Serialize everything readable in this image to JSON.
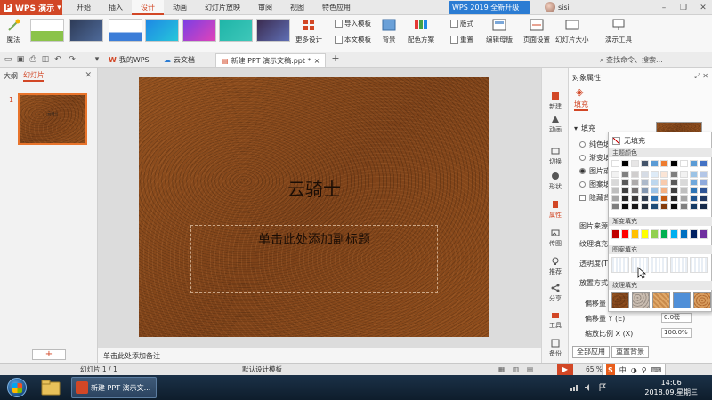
{
  "app": {
    "name": "WPS 演示",
    "accent_color": "#d24726",
    "menu_tabs": [
      "开始",
      "插入",
      "设计",
      "动画",
      "幻灯片放映",
      "审阅",
      "视图",
      "特色应用"
    ],
    "active_menu_tab": "设计",
    "upgrade_label": "WPS 2019 全新升级",
    "user_name": "sisi"
  },
  "ribbon": {
    "magic_label": "魔法",
    "more_designs_label": "更多设计",
    "import_template_label": "导入模板",
    "this_file_template_label": "本文模板",
    "background_label": "背景",
    "color_scheme_label": "配色方案",
    "layout_label": "版式",
    "rearrange_label": "重置",
    "edit_master_label": "编辑母版",
    "page_setup_label": "页面设置",
    "slide_size_label": "幻灯片大小",
    "presenter_tools_label": "演示工具"
  },
  "doc_tabs": [
    {
      "label": "我的WPS",
      "active": false
    },
    {
      "label": "云文档",
      "active": false
    },
    {
      "label": "新建 PPT 演示文稿.ppt *",
      "active": true
    }
  ],
  "search_placeholder": "查找命令、搜索...",
  "left_pane": {
    "tabs": [
      "大纲",
      "幻灯片"
    ],
    "active_tab": "幻灯片",
    "slide_number": "1",
    "thumb_title": "云骑士"
  },
  "slide": {
    "title": "云骑士",
    "subtitle_placeholder": "单击此处添加副标题"
  },
  "notes_placeholder": "单击此处添加备注",
  "side_buttons": [
    "新建",
    "动画",
    "切换",
    "形状",
    "属性",
    "传图",
    "推荐",
    "分享",
    "工具",
    "备份"
  ],
  "active_side_button": "属性",
  "task_pane": {
    "title": "对象属性",
    "fill_tab": "填充",
    "fill_section": "填充",
    "options": [
      "纯色填充",
      "渐变填充",
      "图片或纹理填充",
      "图案填充"
    ],
    "options_short": [
      "纯色填",
      "渐变填",
      "图片或",
      "图案填"
    ],
    "selected_option_index": 2,
    "hide_bg_label": "隐藏背",
    "picture_source_label": "图片来源",
    "texture_fill_label": "纹理填充(",
    "transparency_label": "透明度(T)",
    "placement_label": "放置方式",
    "offset_x_label": "偏移量",
    "offset_y_label": "偏移量 Y (E)",
    "offset_y_value": "0.0磅",
    "scale_x_label": "缩放比例 X (X)",
    "scale_x_value": "100.0%",
    "apply_all_label": "全部应用",
    "reset_bg_label": "重置背景"
  },
  "color_popup": {
    "no_fill_label": "无填充",
    "theme_colors_label": "主题颜色",
    "gradient_fill_label": "渐变填充",
    "pattern_fill_label": "图案填充",
    "texture_fill_label": "纹理填充",
    "theme_top_row": [
      "#ffffff",
      "#000000",
      "#e7e6e6",
      "#44546a",
      "#5b9bd5",
      "#ed7d31",
      "#000000",
      "#ffffff",
      "#5b9bd5",
      "#4472c4"
    ],
    "theme_cols": [
      [
        "#f2f2f2",
        "#d9d9d9",
        "#bfbfbf",
        "#a6a6a6",
        "#7f7f7f"
      ],
      [
        "#808080",
        "#595959",
        "#404040",
        "#262626",
        "#0d0d0d"
      ],
      [
        "#d0cece",
        "#aeabab",
        "#757171",
        "#3a3838",
        "#171616"
      ],
      [
        "#d6dce5",
        "#adb9ca",
        "#8497b0",
        "#333f50",
        "#222a35"
      ],
      [
        "#deebf7",
        "#bdd7ee",
        "#9dc3e6",
        "#2e75b6",
        "#1f4e79"
      ],
      [
        "#fbe5d6",
        "#f8cbad",
        "#f4b183",
        "#c55a11",
        "#843c0c"
      ],
      [
        "#7f7f7f",
        "#595959",
        "#404040",
        "#262626",
        "#0d0d0d"
      ],
      [
        "#f2f2f2",
        "#d9d9d9",
        "#bfbfbf",
        "#a6a6a6",
        "#7f7f7f"
      ],
      [
        "#9cc3e5",
        "#6fa8dc",
        "#2e75b6",
        "#1f5590",
        "#153a63"
      ],
      [
        "#b4c7e7",
        "#8faadc",
        "#2f5597",
        "#203864",
        "#162a4a"
      ]
    ],
    "standard_colors": [
      "#c00000",
      "#ff0000",
      "#ffc000",
      "#ffff00",
      "#92d050",
      "#00b050",
      "#00b0f0",
      "#0070c0",
      "#002060",
      "#7030a0"
    ],
    "textures": [
      "wood-dark",
      "granite",
      "wood-light",
      "blue-plain",
      "oak"
    ]
  },
  "status_bar": {
    "slide_indicator": "幻灯片 1 / 1",
    "template": "默认设计模板",
    "zoom": "65 %",
    "ime_label": "中"
  },
  "taskbar": {
    "wps_task_label": "新建 PPT 演示文...",
    "time": "14:06",
    "date": "2018.09.星期三"
  }
}
